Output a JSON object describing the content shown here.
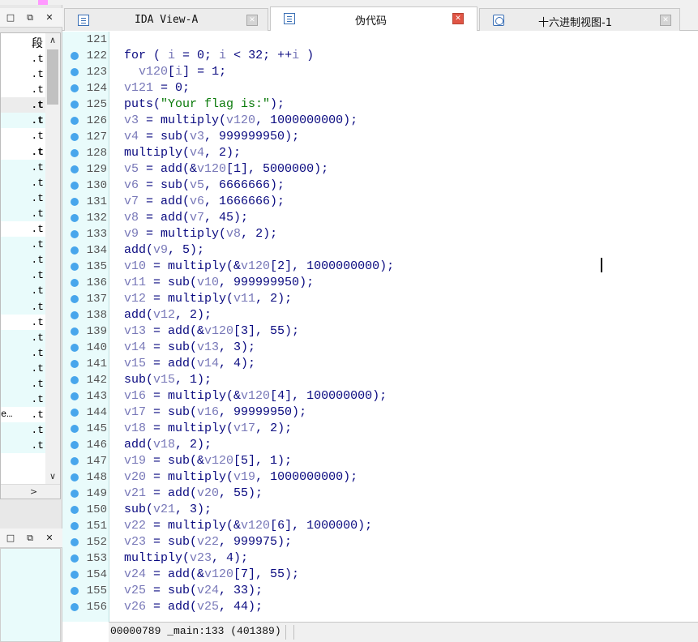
{
  "segments_panel": {
    "header": "段",
    "rows": [
      {
        "text": ".t",
        "prefix": "",
        "bold": false,
        "shade": "white"
      },
      {
        "text": ".t",
        "prefix": "",
        "bold": false,
        "shade": "white"
      },
      {
        "text": ".t",
        "prefix": "",
        "bold": false,
        "shade": "white"
      },
      {
        "text": ".t",
        "prefix": "",
        "bold": true,
        "shade": "gray"
      },
      {
        "text": ".t",
        "prefix": "",
        "bold": true,
        "shade": "cyan"
      },
      {
        "text": ".t",
        "prefix": "",
        "bold": false,
        "shade": "white"
      },
      {
        "text": ".t",
        "prefix": "",
        "bold": true,
        "shade": "white"
      },
      {
        "text": ".t",
        "prefix": "",
        "bold": false,
        "shade": "cyan"
      },
      {
        "text": ".t",
        "prefix": "",
        "bold": false,
        "shade": "cyan"
      },
      {
        "text": ".t",
        "prefix": "",
        "bold": false,
        "shade": "cyan"
      },
      {
        "text": ".t",
        "prefix": "",
        "bold": false,
        "shade": "cyan"
      },
      {
        "text": ".t",
        "prefix": "",
        "bold": false,
        "shade": "white"
      },
      {
        "text": ".t",
        "prefix": "",
        "bold": false,
        "shade": "cyan"
      },
      {
        "text": ".t",
        "prefix": "",
        "bold": false,
        "shade": "cyan"
      },
      {
        "text": ".t",
        "prefix": "",
        "bold": false,
        "shade": "cyan"
      },
      {
        "text": ".t",
        "prefix": "",
        "bold": false,
        "shade": "cyan"
      },
      {
        "text": ".t",
        "prefix": "",
        "bold": false,
        "shade": "cyan"
      },
      {
        "text": ".t",
        "prefix": "",
        "bold": false,
        "shade": "white"
      },
      {
        "text": ".t",
        "prefix": "",
        "bold": false,
        "shade": "cyan"
      },
      {
        "text": ".t",
        "prefix": "",
        "bold": false,
        "shade": "cyan"
      },
      {
        "text": ".t",
        "prefix": "",
        "bold": false,
        "shade": "cyan"
      },
      {
        "text": ".t",
        "prefix": "",
        "bold": false,
        "shade": "cyan"
      },
      {
        "text": ".t",
        "prefix": "",
        "bold": false,
        "shade": "cyan"
      },
      {
        "text": ".t",
        "prefix": "e…",
        "bold": false,
        "shade": "white"
      },
      {
        "text": ".t",
        "prefix": "",
        "bold": false,
        "shade": "cyan"
      },
      {
        "text": ".t",
        "prefix": "",
        "bold": false,
        "shade": "cyan"
      }
    ]
  },
  "window_buttons": {
    "restore": "□",
    "float": "⧉",
    "close": "✕"
  },
  "scroll": {
    "up": "∧",
    "down": "∨",
    "right": ">"
  },
  "tabs": [
    {
      "label": "IDA View-A",
      "icon": "disassembly-icon",
      "close": "✕",
      "active": false
    },
    {
      "label": "伪代码",
      "icon": "pseudocode-icon",
      "close": "✕",
      "active": true
    },
    {
      "label": "十六进制视图-1",
      "icon": "hex-view-icon",
      "close": "✕",
      "active": false
    }
  ],
  "code": [
    {
      "n": "121",
      "dot": false,
      "html": ""
    },
    {
      "n": "122",
      "dot": true,
      "html": "for ( <span class=\"v\">i</span> = 0; <span class=\"v\">i</span> &lt; 32; ++<span class=\"v\">i</span> )"
    },
    {
      "n": "123",
      "dot": true,
      "html": "  <span class=\"v\">v120</span>[<span class=\"v\">i</span>] = 1;"
    },
    {
      "n": "124",
      "dot": true,
      "html": "<span class=\"v\">v121</span> = 0;"
    },
    {
      "n": "125",
      "dot": true,
      "html": "puts(<span class=\"s\">\"Your flag is:\"</span>);"
    },
    {
      "n": "126",
      "dot": true,
      "html": "<span class=\"v\">v3</span> = multiply(<span class=\"v\">v120</span>, 1000000000);"
    },
    {
      "n": "127",
      "dot": true,
      "html": "<span class=\"v\">v4</span> = sub(<span class=\"v\">v3</span>, 999999950);"
    },
    {
      "n": "128",
      "dot": true,
      "html": "multiply(<span class=\"v\">v4</span>, 2);"
    },
    {
      "n": "129",
      "dot": true,
      "html": "<span class=\"v\">v5</span> = add(&amp;<span class=\"v\">v120</span>[1], 5000000);"
    },
    {
      "n": "130",
      "dot": true,
      "html": "<span class=\"v\">v6</span> = sub(<span class=\"v\">v5</span>, 6666666);"
    },
    {
      "n": "131",
      "dot": true,
      "html": "<span class=\"v\">v7</span> = add(<span class=\"v\">v6</span>, 1666666);"
    },
    {
      "n": "132",
      "dot": true,
      "html": "<span class=\"v\">v8</span> = add(<span class=\"v\">v7</span>, 45);"
    },
    {
      "n": "133",
      "dot": true,
      "html": "<span class=\"v\">v9</span> = multiply(<span class=\"v\">v8</span>, 2);"
    },
    {
      "n": "134",
      "dot": true,
      "html": "add(<span class=\"v\">v9</span>, 5);"
    },
    {
      "n": "135",
      "dot": true,
      "html": "<span class=\"v\">v10</span> = multiply(&amp;<span class=\"v\">v120</span>[2], 1000000000);"
    },
    {
      "n": "136",
      "dot": true,
      "html": "<span class=\"v\">v11</span> = sub(<span class=\"v\">v10</span>, 999999950);"
    },
    {
      "n": "137",
      "dot": true,
      "html": "<span class=\"v\">v12</span> = multiply(<span class=\"v\">v11</span>, 2);"
    },
    {
      "n": "138",
      "dot": true,
      "html": "add(<span class=\"v\">v12</span>, 2);"
    },
    {
      "n": "139",
      "dot": true,
      "html": "<span class=\"v\">v13</span> = add(&amp;<span class=\"v\">v120</span>[3], 55);"
    },
    {
      "n": "140",
      "dot": true,
      "html": "<span class=\"v\">v14</span> = sub(<span class=\"v\">v13</span>, 3);"
    },
    {
      "n": "141",
      "dot": true,
      "html": "<span class=\"v\">v15</span> = add(<span class=\"v\">v14</span>, 4);"
    },
    {
      "n": "142",
      "dot": true,
      "html": "sub(<span class=\"v\">v15</span>, 1);"
    },
    {
      "n": "143",
      "dot": true,
      "html": "<span class=\"v\">v16</span> = multiply(&amp;<span class=\"v\">v120</span>[4], 100000000);"
    },
    {
      "n": "144",
      "dot": true,
      "html": "<span class=\"v\">v17</span> = sub(<span class=\"v\">v16</span>, 99999950);"
    },
    {
      "n": "145",
      "dot": true,
      "html": "<span class=\"v\">v18</span> = multiply(<span class=\"v\">v17</span>, 2);"
    },
    {
      "n": "146",
      "dot": true,
      "html": "add(<span class=\"v\">v18</span>, 2);"
    },
    {
      "n": "147",
      "dot": true,
      "html": "<span class=\"v\">v19</span> = sub(&amp;<span class=\"v\">v120</span>[5], 1);"
    },
    {
      "n": "148",
      "dot": true,
      "html": "<span class=\"v\">v20</span> = multiply(<span class=\"v\">v19</span>, 1000000000);"
    },
    {
      "n": "149",
      "dot": true,
      "html": "<span class=\"v\">v21</span> = add(<span class=\"v\">v20</span>, 55);"
    },
    {
      "n": "150",
      "dot": true,
      "html": "sub(<span class=\"v\">v21</span>, 3);"
    },
    {
      "n": "151",
      "dot": true,
      "html": "<span class=\"v\">v22</span> = multiply(&amp;<span class=\"v\">v120</span>[6], 1000000);"
    },
    {
      "n": "152",
      "dot": true,
      "html": "<span class=\"v\">v23</span> = sub(<span class=\"v\">v22</span>, 999975);"
    },
    {
      "n": "153",
      "dot": true,
      "html": "multiply(<span class=\"v\">v23</span>, 4);"
    },
    {
      "n": "154",
      "dot": true,
      "html": "<span class=\"v\">v24</span> = add(&amp;<span class=\"v\">v120</span>[7], 55);"
    },
    {
      "n": "155",
      "dot": true,
      "html": "<span class=\"v\">v25</span> = sub(<span class=\"v\">v24</span>, 33);"
    },
    {
      "n": "156",
      "dot": true,
      "html": "<span class=\"v\">v26</span> = add(<span class=\"v\">v25</span>, 44);"
    }
  ],
  "status": {
    "text": "00000789 _main:133 (401389)"
  },
  "colors": {
    "gutter_bg": "#e9fbfb",
    "breakpoint_dot": "#48a6ec",
    "code_text": "#0a0a80",
    "variable": "#7878b8",
    "string": "#0a7a0a",
    "active_tab_close": "#e05545"
  }
}
